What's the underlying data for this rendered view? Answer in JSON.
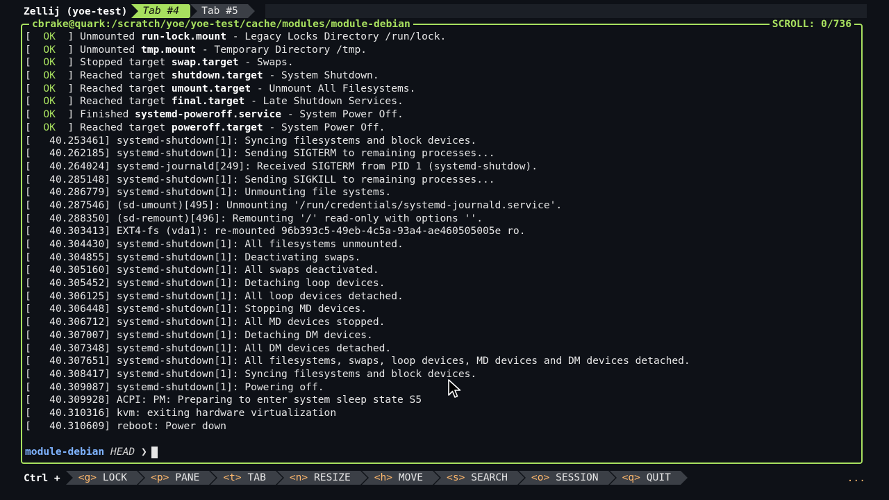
{
  "tabbar": {
    "session": "Zellij (yoe-test)",
    "tabs": [
      {
        "label": "Tab #4",
        "active": true
      },
      {
        "label": "Tab #5",
        "active": false
      }
    ]
  },
  "pane": {
    "title": "cbrake@quark:/scratch/yoe/yoe-test/cache/modules/module-debian",
    "scroll": "SCROLL:  0/736"
  },
  "log": [
    {
      "status": "OK",
      "pre": "Unmounted ",
      "bold": "run-lock.mount",
      "post": " - Legacy Locks Directory /run/lock."
    },
    {
      "status": "OK",
      "pre": "Unmounted ",
      "bold": "tmp.mount",
      "post": " - Temporary Directory /tmp."
    },
    {
      "status": "OK",
      "pre": "Stopped target ",
      "bold": "swap.target",
      "post": " - Swaps."
    },
    {
      "status": "OK",
      "pre": "Reached target ",
      "bold": "shutdown.target",
      "post": " - System Shutdown."
    },
    {
      "status": "OK",
      "pre": "Reached target ",
      "bold": "umount.target",
      "post": " - Unmount All Filesystems."
    },
    {
      "status": "OK",
      "pre": "Reached target ",
      "bold": "final.target",
      "post": " - Late Shutdown Services."
    },
    {
      "status": "OK",
      "pre": "Finished ",
      "bold": "systemd-poweroff.service",
      "post": " - System Power Off."
    },
    {
      "status": "OK",
      "pre": "Reached target ",
      "bold": "poweroff.target",
      "post": " - System Power Off."
    },
    {
      "time": "40.253461",
      "msg": "systemd-shutdown[1]: Syncing filesystems and block devices."
    },
    {
      "time": "40.262185",
      "msg": "systemd-shutdown[1]: Sending SIGTERM to remaining processes..."
    },
    {
      "time": "40.264024",
      "msg": "systemd-journald[249]: Received SIGTERM from PID 1 (systemd-shutdow)."
    },
    {
      "time": "40.285148",
      "msg": "systemd-shutdown[1]: Sending SIGKILL to remaining processes..."
    },
    {
      "time": "40.286779",
      "msg": "systemd-shutdown[1]: Unmounting file systems."
    },
    {
      "time": "40.287546",
      "msg": "(sd-umount)[495]: Unmounting '/run/credentials/systemd-journald.service'."
    },
    {
      "time": "40.288350",
      "msg": "(sd-remount)[496]: Remounting '/' read-only with options ''."
    },
    {
      "time": "40.303413",
      "msg": "EXT4-fs (vda1): re-mounted 96b393c5-49eb-4c5a-93a4-ae460505005e ro."
    },
    {
      "time": "40.304430",
      "msg": "systemd-shutdown[1]: All filesystems unmounted."
    },
    {
      "time": "40.304855",
      "msg": "systemd-shutdown[1]: Deactivating swaps."
    },
    {
      "time": "40.305160",
      "msg": "systemd-shutdown[1]: All swaps deactivated."
    },
    {
      "time": "40.305452",
      "msg": "systemd-shutdown[1]: Detaching loop devices."
    },
    {
      "time": "40.306125",
      "msg": "systemd-shutdown[1]: All loop devices detached."
    },
    {
      "time": "40.306448",
      "msg": "systemd-shutdown[1]: Stopping MD devices."
    },
    {
      "time": "40.306712",
      "msg": "systemd-shutdown[1]: All MD devices stopped."
    },
    {
      "time": "40.307007",
      "msg": "systemd-shutdown[1]: Detaching DM devices."
    },
    {
      "time": "40.307348",
      "msg": "systemd-shutdown[1]: All DM devices detached."
    },
    {
      "time": "40.307651",
      "msg": "systemd-shutdown[1]: All filesystems, swaps, loop devices, MD devices and DM devices detached."
    },
    {
      "time": "40.308417",
      "msg": "systemd-shutdown[1]: Syncing filesystems and block devices."
    },
    {
      "time": "40.309087",
      "msg": "systemd-shutdown[1]: Powering off."
    },
    {
      "time": "40.309928",
      "msg": "ACPI: PM: Preparing to enter system sleep state S5"
    },
    {
      "time": "40.310316",
      "msg": "kvm: exiting hardware virtualization"
    },
    {
      "time": "40.310609",
      "msg": "reboot: Power down"
    }
  ],
  "prompt": {
    "dir": "module-debian",
    "branch": "HEAD",
    "arrow": "❯"
  },
  "statusbar": {
    "modifier": "Ctrl +",
    "keys": [
      {
        "key": "<g>",
        "label": "LOCK"
      },
      {
        "key": "<p>",
        "label": "PANE"
      },
      {
        "key": "<t>",
        "label": "TAB"
      },
      {
        "key": "<n>",
        "label": "RESIZE"
      },
      {
        "key": "<h>",
        "label": "MOVE"
      },
      {
        "key": "<s>",
        "label": "SEARCH"
      },
      {
        "key": "<o>",
        "label": "SESSION"
      },
      {
        "key": "<q>",
        "label": "QUIT"
      }
    ],
    "overflow": "..."
  },
  "colors": {
    "accent": "#a8e05f",
    "background": "#0e1117",
    "key_hint": "#ffb86c"
  }
}
